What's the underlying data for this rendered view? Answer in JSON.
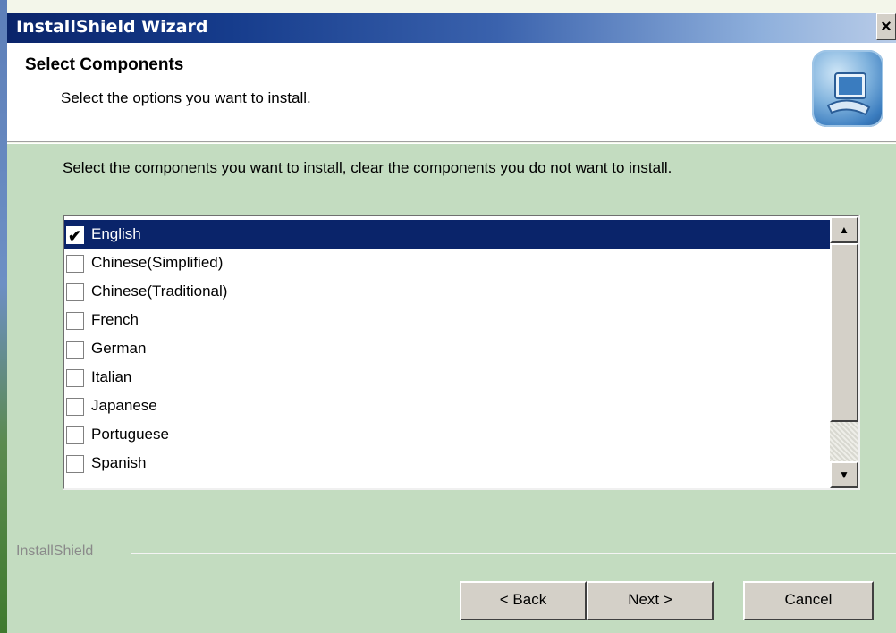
{
  "window": {
    "title": "InstallShield Wizard",
    "close_label": "×"
  },
  "header": {
    "title": "Select Components",
    "subtitle": "Select the options you want to install.",
    "icon": "setup-monitor-icon"
  },
  "instructions": "Select the components you want to install, clear the components you do not want to install.",
  "components": [
    {
      "label": "English",
      "checked": true,
      "selected": true
    },
    {
      "label": "Chinese(Simplified)",
      "checked": false,
      "selected": false
    },
    {
      "label": "Chinese(Traditional)",
      "checked": false,
      "selected": false
    },
    {
      "label": "French",
      "checked": false,
      "selected": false
    },
    {
      "label": "German",
      "checked": false,
      "selected": false
    },
    {
      "label": "Italian",
      "checked": false,
      "selected": false
    },
    {
      "label": "Japanese",
      "checked": false,
      "selected": false
    },
    {
      "label": "Portuguese",
      "checked": false,
      "selected": false
    },
    {
      "label": "Spanish",
      "checked": false,
      "selected": false
    }
  ],
  "scrollbar": {
    "up_glyph": "▲",
    "down_glyph": "▼"
  },
  "footer": {
    "brand": "InstallShield",
    "back_label": "< Back",
    "next_label": "Next >",
    "cancel_label": "Cancel"
  },
  "colors": {
    "selection": "#0a246a",
    "body_background": "#c3dcc0",
    "button_face": "#d4d0c8"
  }
}
